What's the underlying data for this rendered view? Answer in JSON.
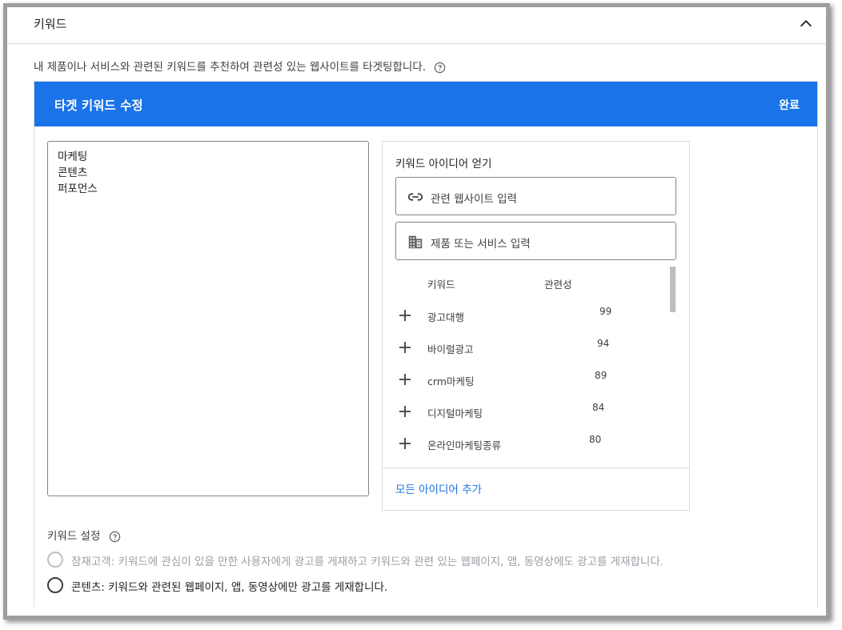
{
  "panel": {
    "title": "키워드"
  },
  "description": "내 제품이나 서비스와 관련된 키워드를 추천하여 관련성 있는 웹사이트를 타겟팅합니다.",
  "edit_header": {
    "title": "타겟 키워드 수정",
    "done_label": "완료"
  },
  "keywords_text": [
    "마케팅",
    "콘텐츠",
    "퍼포먼스"
  ],
  "ideas": {
    "title": "키워드 아이디어 얻기",
    "website_input_placeholder": "관련 웹사이트 입력",
    "product_input_placeholder": "제품 또는 서비스 입력",
    "col_keyword": "키워드",
    "col_relevance": "관련성",
    "suggestions": [
      {
        "keyword": "광고대행",
        "relevance": "99"
      },
      {
        "keyword": "바이럴광고",
        "relevance": "94"
      },
      {
        "keyword": "crm마케팅",
        "relevance": "89"
      },
      {
        "keyword": "디지털마케팅",
        "relevance": "84"
      },
      {
        "keyword": "온라인마케팅종류",
        "relevance": "80"
      }
    ],
    "add_all_label": "모든 아이디어 추가"
  },
  "settings": {
    "title": "키워드 설정",
    "options": [
      {
        "label": "잠재고객: 키워드에 관심이 있을 만한 사용자에게 광고를 게재하고 키워드와 관련 있는 웹페이지, 앱, 동영상에도 광고를 게재합니다.",
        "state": "disabled"
      },
      {
        "label": "콘텐츠: 키워드와 관련된 웹페이지, 앱, 동영상에만 광고를 게재합니다.",
        "state": "enabled"
      }
    ]
  },
  "colors": {
    "accent": "#1a73e8",
    "border": "#dadce0",
    "text": "#202124",
    "muted": "#9aa0a6"
  },
  "icons": {
    "collapse": "chevron-up-icon",
    "help": "help-circle-icon",
    "link": "link-icon",
    "business": "building-icon",
    "add": "plus-icon"
  }
}
